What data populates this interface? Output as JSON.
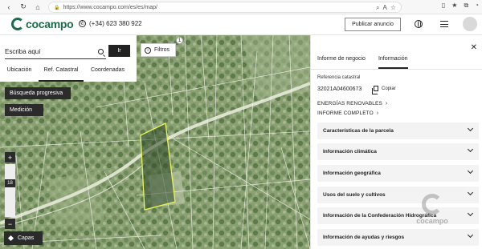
{
  "browser": {
    "url": "https://www.cocampo.com/es/es/map/",
    "nav_back_icon": "back-icon",
    "nav_reload_icon": "reload-icon",
    "nav_home_icon": "home-icon"
  },
  "header": {
    "brand": "cocampo",
    "phone": "(+34) 623 380 922",
    "publish_label": "Publicar anuncio",
    "brand_color": "#1d6b4a"
  },
  "map": {
    "search_placeholder": "Escriba aquí",
    "go_label": "Ir",
    "tabs": [
      {
        "label": "Ubicación",
        "active": false
      },
      {
        "label": "Ref. Catastral",
        "active": true
      },
      {
        "label": "Coordenadas",
        "active": false
      }
    ],
    "filters_label": "Filtros",
    "filters_badge": "1",
    "progressive_label": "Búsqueda progresiva",
    "measure_label": "Medición",
    "zoom_in": "+",
    "zoom_level": "18",
    "zoom_out": "−",
    "layers_label": "Capas",
    "parcel_highlight_color": "#e9f25a"
  },
  "panel": {
    "close_icon": "close-icon",
    "tabs": [
      {
        "label": "Informe de negocio",
        "active": false
      },
      {
        "label": "Información",
        "active": true
      }
    ],
    "ref_label": "Referencia catastral",
    "ref_value": "32021A04600673",
    "copy_label": "Copiar",
    "energy_link": "ENERGÍAS RENOVABLES",
    "report_link": "INFORME COMPLETO",
    "sections": [
      "Características de la parcela",
      "Información climática",
      "Información geográfica",
      "Usos del suelo y cultivos",
      "Información de la Confederación Hidrográfica",
      "Información de ayudas y riesgos"
    ],
    "watermark_text": "cocampo"
  }
}
